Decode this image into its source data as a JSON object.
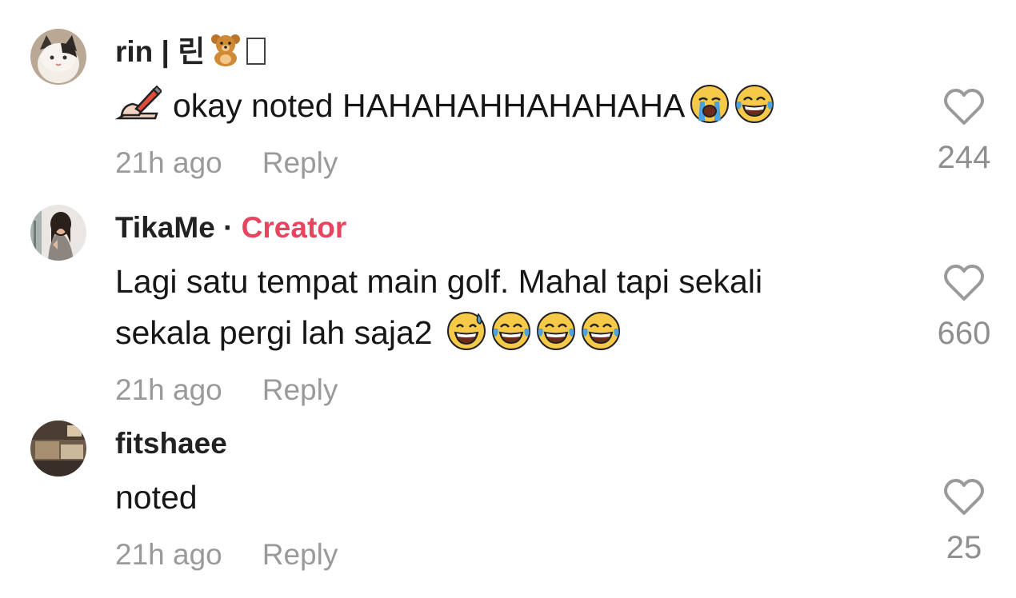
{
  "comments": [
    {
      "username": "rin | 린",
      "text": "okay noted HAHAHAHHAHAHAHA",
      "time": "21h ago",
      "reply_label": "Reply",
      "likes": "244",
      "avatar": "cat-avatar"
    },
    {
      "username": "TikaMe",
      "separator": "·",
      "badge": "Creator",
      "text_line1": "Lagi satu tempat main golf. Mahal tapi sekali",
      "text_line2": "sekala pergi lah saja2",
      "time": "21h ago",
      "reply_label": "Reply",
      "likes": "660",
      "avatar": "woman-avatar"
    },
    {
      "username": "fitshaee",
      "text": "noted",
      "time": "21h ago",
      "reply_label": "Reply",
      "likes": "25",
      "avatar": "photo-avatar"
    }
  ],
  "colors": {
    "creator_badge": "#e8445e",
    "meta_gray": "#9a9a9a",
    "text": "#161616"
  }
}
